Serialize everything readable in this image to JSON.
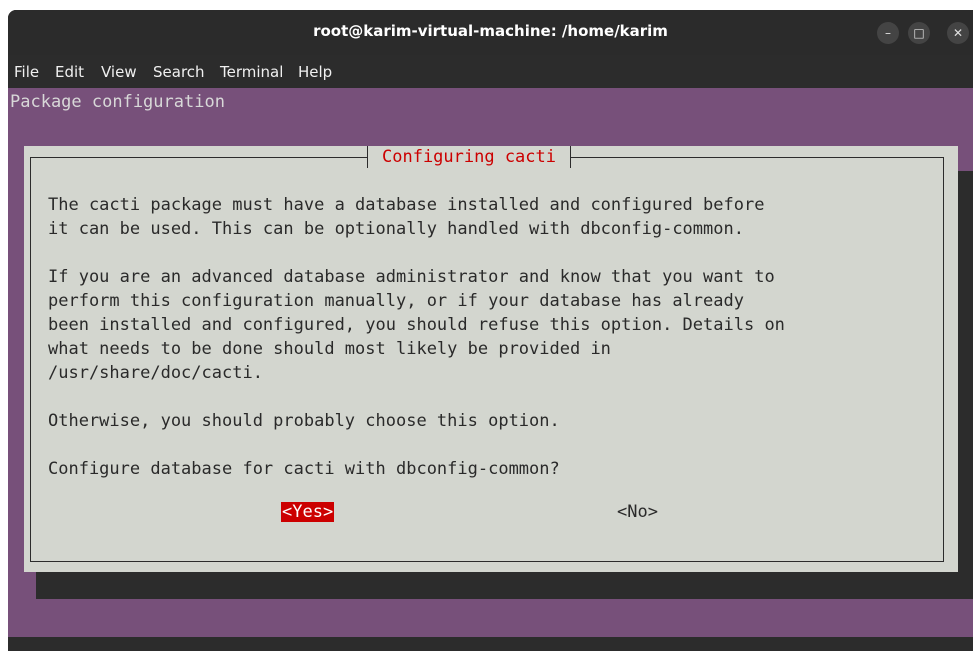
{
  "window": {
    "title": "root@karim-virtual-machine: /home/karim",
    "controls": {
      "minimize_glyph": "–",
      "maximize_glyph": "□",
      "close_glyph": "✕"
    }
  },
  "menu": {
    "items": [
      "File",
      "Edit",
      "View",
      "Search",
      "Terminal",
      "Help"
    ]
  },
  "terminal": {
    "header": "Package configuration"
  },
  "dialog": {
    "title": "Configuring cacti",
    "paragraph1": [
      "The cacti package must have a database installed and configured before",
      "it can be used. This can be optionally handled with dbconfig-common."
    ],
    "paragraph2": [
      "If you are an advanced database administrator and know that you want to",
      "perform this configuration manually, or if your database has already",
      "been installed and configured, you should refuse this option. Details on",
      "what needs to be done should most likely be provided in",
      "/usr/share/doc/cacti."
    ],
    "paragraph3": "Otherwise, you should probably choose this option.",
    "question": "Configure database for cacti with dbconfig-common?",
    "yes_label": "<Yes>",
    "no_label": "<No>"
  },
  "colors": {
    "terminal_bg": "#77507a",
    "dialog_bg": "#d3d6cf",
    "accent_red": "#cc0000",
    "chrome_dark": "#2c2c2c"
  }
}
